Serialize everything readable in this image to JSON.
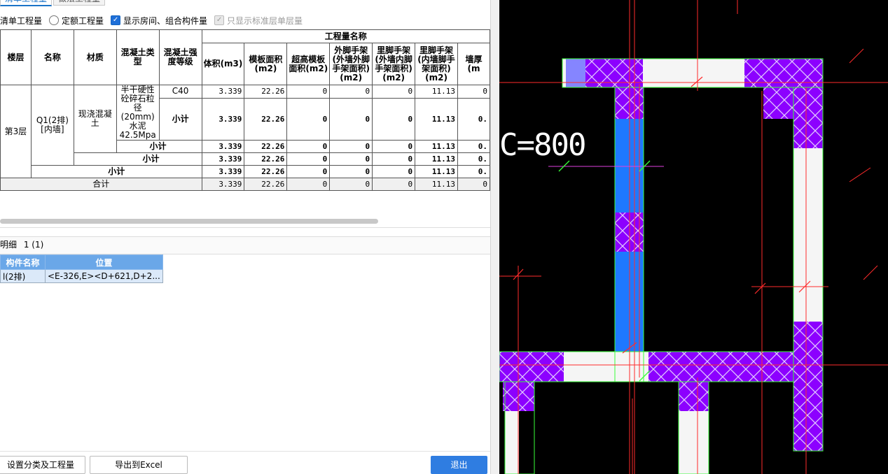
{
  "tabs": [
    "清单工程量",
    "做法工程量"
  ],
  "options": {
    "qingdan": "清单工程量",
    "dinge": "定额工程量",
    "show_rooms": "显示房间、组合构件量",
    "std_floor": "只显示标准层单层量"
  },
  "table": {
    "group_header": "工程量名称",
    "headers": {
      "floor": "楼层",
      "name": "名称",
      "material": "材质",
      "concrete_type": "混凝土类型",
      "concrete_grade": "混凝土强度等级",
      "volume": "体积(m3)",
      "formwork": "模板面积(m2)",
      "high_formwork": "超高模板面积(m2)",
      "outer_scaffold": "外脚手架(外墙外脚手架面积)(m2)",
      "inner_scaffold": "里脚手架(外墙内脚手架面积)(m2)",
      "inner_wall_scaffold": "里脚手架(内墙脚手架面积)(m2)",
      "wall_thickness": "墙厚(m"
    },
    "floor": "第3层",
    "name": "Q1(2排)[内墙]",
    "material": "现浇混凝土",
    "concrete_type": "半干硬性砼碎石粒径(20mm)水泥42.5Mpa",
    "grade": "C40",
    "subtotal_label": "小计",
    "total_label": "合计",
    "row_values": [
      "3.339",
      "22.26",
      "0",
      "0",
      "0",
      "11.13",
      "0"
    ],
    "sub1_values": [
      "3.339",
      "22.26",
      "0",
      "0",
      "0",
      "11.13",
      "0."
    ],
    "sub2_values": [
      "3.339",
      "22.26",
      "0",
      "0",
      "0",
      "11.13",
      "0."
    ],
    "sub3_values": [
      "3.339",
      "22.26",
      "0",
      "0",
      "0",
      "11.13",
      "0."
    ],
    "sub4_values": [
      "3.339",
      "22.26",
      "0",
      "0",
      "0",
      "11.13",
      "0."
    ],
    "total_values": [
      "3.339",
      "22.26",
      "0",
      "0",
      "0",
      "11.13",
      "0"
    ]
  },
  "detail": {
    "title": "明细",
    "count": "1 (1)",
    "col_name": "构件名称",
    "col_pos": "位置",
    "row_name": "l(2排)",
    "row_pos": "<E-326,E><D+621,D+2..."
  },
  "buttons": {
    "settings": "设置分类及工程量",
    "export": "导出到Excel",
    "exit": "退出"
  },
  "cad": {
    "label": "C=800"
  }
}
